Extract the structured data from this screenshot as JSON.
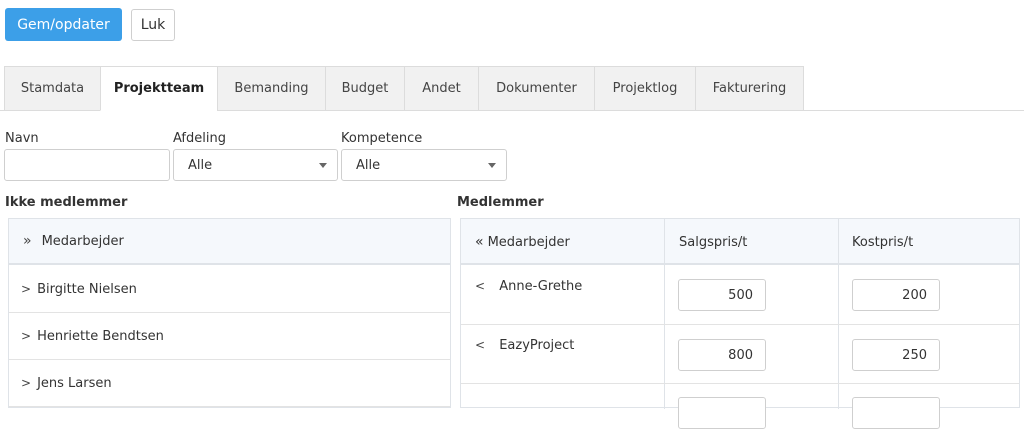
{
  "toolbar": {
    "save_label": "Gem/opdater",
    "close_label": "Luk",
    "accent": "#3c9fe8"
  },
  "tabs": [
    {
      "label": "Stamdata"
    },
    {
      "label": "Projektteam",
      "active": true
    },
    {
      "label": "Bemanding"
    },
    {
      "label": "Budget"
    },
    {
      "label": "Andet"
    },
    {
      "label": "Dokumenter"
    },
    {
      "label": "Projektlog"
    },
    {
      "label": "Fakturering"
    }
  ],
  "filters": {
    "name_label": "Navn",
    "name_value": "",
    "dept_label": "Afdeling",
    "dept_value": "Alle",
    "skill_label": "Kompetence",
    "skill_value": "Alle"
  },
  "non_members": {
    "title": "Ikke medlemmer",
    "header": "Medarbejder",
    "header_icon": "double-chevron-right-icon",
    "rows": [
      "Birgitte Nielsen",
      "Henriette Bendtsen",
      "Jens Larsen"
    ]
  },
  "members": {
    "title": "Medlemmer",
    "columns": [
      "Medarbejder",
      "Salgspris/t",
      "Kostpris/t"
    ],
    "header_icon": "double-chevron-left-icon",
    "rows": [
      {
        "name": "Anne-Grethe",
        "sales": "500",
        "cost": "200"
      },
      {
        "name": "EazyProject",
        "sales": "800",
        "cost": "250"
      }
    ]
  }
}
